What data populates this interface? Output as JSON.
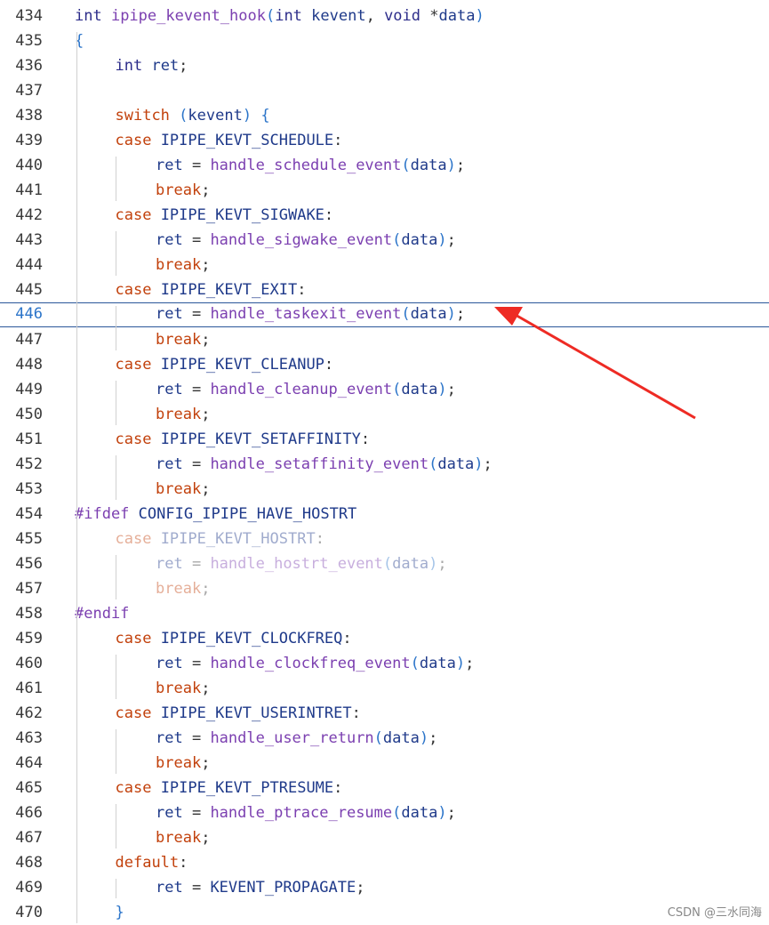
{
  "editor": {
    "current_line": "446",
    "lines": [
      {
        "num": "434",
        "indent": 0,
        "tokens": [
          [
            "ty",
            "int "
          ],
          [
            "fn",
            "ipipe_kevent_hook"
          ],
          [
            "br",
            "("
          ],
          [
            "ty",
            "int "
          ],
          [
            "id",
            "kevent"
          ],
          [
            "pu",
            ", "
          ],
          [
            "ty",
            "void "
          ],
          [
            "pu",
            "*"
          ],
          [
            "id",
            "data"
          ],
          [
            "br",
            ")"
          ]
        ]
      },
      {
        "num": "435",
        "indent": 0,
        "tokens": [
          [
            "br",
            "{"
          ]
        ]
      },
      {
        "num": "436",
        "indent": 1,
        "tokens": [
          [
            "ty",
            "int "
          ],
          [
            "id",
            "ret"
          ],
          [
            "pu",
            ";"
          ]
        ]
      },
      {
        "num": "437",
        "indent": 0,
        "tokens": []
      },
      {
        "num": "438",
        "indent": 1,
        "tokens": [
          [
            "kw",
            "switch "
          ],
          [
            "br",
            "("
          ],
          [
            "id",
            "kevent"
          ],
          [
            "br",
            ")"
          ],
          [
            "pu",
            " "
          ],
          [
            "br",
            "{"
          ]
        ]
      },
      {
        "num": "439",
        "indent": 1,
        "tokens": [
          [
            "kw",
            "case "
          ],
          [
            "id",
            "IPIPE_KEVT_SCHEDULE"
          ],
          [
            "pu",
            ":"
          ]
        ]
      },
      {
        "num": "440",
        "indent": 2,
        "tokens": [
          [
            "id",
            "ret "
          ],
          [
            "pu",
            "= "
          ],
          [
            "fn",
            "handle_schedule_event"
          ],
          [
            "br",
            "("
          ],
          [
            "id",
            "data"
          ],
          [
            "br",
            ")"
          ],
          [
            "pu",
            ";"
          ]
        ]
      },
      {
        "num": "441",
        "indent": 2,
        "tokens": [
          [
            "kw",
            "break"
          ],
          [
            "pu",
            ";"
          ]
        ]
      },
      {
        "num": "442",
        "indent": 1,
        "tokens": [
          [
            "kw",
            "case "
          ],
          [
            "id",
            "IPIPE_KEVT_SIGWAKE"
          ],
          [
            "pu",
            ":"
          ]
        ]
      },
      {
        "num": "443",
        "indent": 2,
        "tokens": [
          [
            "id",
            "ret "
          ],
          [
            "pu",
            "= "
          ],
          [
            "fn",
            "handle_sigwake_event"
          ],
          [
            "br",
            "("
          ],
          [
            "id",
            "data"
          ],
          [
            "br",
            ")"
          ],
          [
            "pu",
            ";"
          ]
        ]
      },
      {
        "num": "444",
        "indent": 2,
        "tokens": [
          [
            "kw",
            "break"
          ],
          [
            "pu",
            ";"
          ]
        ]
      },
      {
        "num": "445",
        "indent": 1,
        "tokens": [
          [
            "kw",
            "case "
          ],
          [
            "id",
            "IPIPE_KEVT_EXIT"
          ],
          [
            "pu",
            ":"
          ]
        ]
      },
      {
        "num": "446",
        "indent": 2,
        "tokens": [
          [
            "id",
            "ret "
          ],
          [
            "pu",
            "= "
          ],
          [
            "fn",
            "handle_taskexit_event"
          ],
          [
            "br",
            "("
          ],
          [
            "id",
            "data"
          ],
          [
            "br",
            ")"
          ],
          [
            "pu",
            ";"
          ]
        ]
      },
      {
        "num": "447",
        "indent": 2,
        "tokens": [
          [
            "kw",
            "break"
          ],
          [
            "pu",
            ";"
          ]
        ]
      },
      {
        "num": "448",
        "indent": 1,
        "tokens": [
          [
            "kw",
            "case "
          ],
          [
            "id",
            "IPIPE_KEVT_CLEANUP"
          ],
          [
            "pu",
            ":"
          ]
        ]
      },
      {
        "num": "449",
        "indent": 2,
        "tokens": [
          [
            "id",
            "ret "
          ],
          [
            "pu",
            "= "
          ],
          [
            "fn",
            "handle_cleanup_event"
          ],
          [
            "br",
            "("
          ],
          [
            "id",
            "data"
          ],
          [
            "br",
            ")"
          ],
          [
            "pu",
            ";"
          ]
        ]
      },
      {
        "num": "450",
        "indent": 2,
        "tokens": [
          [
            "kw",
            "break"
          ],
          [
            "pu",
            ";"
          ]
        ]
      },
      {
        "num": "451",
        "indent": 1,
        "tokens": [
          [
            "kw",
            "case "
          ],
          [
            "id",
            "IPIPE_KEVT_SETAFFINITY"
          ],
          [
            "pu",
            ":"
          ]
        ]
      },
      {
        "num": "452",
        "indent": 2,
        "tokens": [
          [
            "id",
            "ret "
          ],
          [
            "pu",
            "= "
          ],
          [
            "fn",
            "handle_setaffinity_event"
          ],
          [
            "br",
            "("
          ],
          [
            "id",
            "data"
          ],
          [
            "br",
            ")"
          ],
          [
            "pu",
            ";"
          ]
        ]
      },
      {
        "num": "453",
        "indent": 2,
        "tokens": [
          [
            "kw",
            "break"
          ],
          [
            "pu",
            ";"
          ]
        ]
      },
      {
        "num": "454",
        "indent": 0,
        "tokens": [
          [
            "pp",
            "#ifdef "
          ],
          [
            "id",
            "CONFIG_IPIPE_HAVE_HOSTRT"
          ]
        ]
      },
      {
        "num": "455",
        "indent": 1,
        "dim": true,
        "tokens": [
          [
            "kw",
            "case "
          ],
          [
            "id",
            "IPIPE_KEVT_HOSTRT"
          ],
          [
            "pu",
            ":"
          ]
        ]
      },
      {
        "num": "456",
        "indent": 2,
        "dim": true,
        "tokens": [
          [
            "id",
            "ret "
          ],
          [
            "pu",
            "= "
          ],
          [
            "fn",
            "handle_hostrt_event"
          ],
          [
            "br",
            "("
          ],
          [
            "id",
            "data"
          ],
          [
            "br",
            ")"
          ],
          [
            "pu",
            ";"
          ]
        ]
      },
      {
        "num": "457",
        "indent": 2,
        "dim": true,
        "tokens": [
          [
            "kw",
            "break"
          ],
          [
            "pu",
            ";"
          ]
        ]
      },
      {
        "num": "458",
        "indent": 0,
        "tokens": [
          [
            "pp",
            "#endif"
          ]
        ]
      },
      {
        "num": "459",
        "indent": 1,
        "tokens": [
          [
            "kw",
            "case "
          ],
          [
            "id",
            "IPIPE_KEVT_CLOCKFREQ"
          ],
          [
            "pu",
            ":"
          ]
        ]
      },
      {
        "num": "460",
        "indent": 2,
        "tokens": [
          [
            "id",
            "ret "
          ],
          [
            "pu",
            "= "
          ],
          [
            "fn",
            "handle_clockfreq_event"
          ],
          [
            "br",
            "("
          ],
          [
            "id",
            "data"
          ],
          [
            "br",
            ")"
          ],
          [
            "pu",
            ";"
          ]
        ]
      },
      {
        "num": "461",
        "indent": 2,
        "tokens": [
          [
            "kw",
            "break"
          ],
          [
            "pu",
            ";"
          ]
        ]
      },
      {
        "num": "462",
        "indent": 1,
        "tokens": [
          [
            "kw",
            "case "
          ],
          [
            "id",
            "IPIPE_KEVT_USERINTRET"
          ],
          [
            "pu",
            ":"
          ]
        ]
      },
      {
        "num": "463",
        "indent": 2,
        "tokens": [
          [
            "id",
            "ret "
          ],
          [
            "pu",
            "= "
          ],
          [
            "fn",
            "handle_user_return"
          ],
          [
            "br",
            "("
          ],
          [
            "id",
            "data"
          ],
          [
            "br",
            ")"
          ],
          [
            "pu",
            ";"
          ]
        ]
      },
      {
        "num": "464",
        "indent": 2,
        "tokens": [
          [
            "kw",
            "break"
          ],
          [
            "pu",
            ";"
          ]
        ]
      },
      {
        "num": "465",
        "indent": 1,
        "tokens": [
          [
            "kw",
            "case "
          ],
          [
            "id",
            "IPIPE_KEVT_PTRESUME"
          ],
          [
            "pu",
            ":"
          ]
        ]
      },
      {
        "num": "466",
        "indent": 2,
        "tokens": [
          [
            "id",
            "ret "
          ],
          [
            "pu",
            "= "
          ],
          [
            "fn",
            "handle_ptrace_resume"
          ],
          [
            "br",
            "("
          ],
          [
            "id",
            "data"
          ],
          [
            "br",
            ")"
          ],
          [
            "pu",
            ";"
          ]
        ]
      },
      {
        "num": "467",
        "indent": 2,
        "tokens": [
          [
            "kw",
            "break"
          ],
          [
            "pu",
            ";"
          ]
        ]
      },
      {
        "num": "468",
        "indent": 1,
        "tokens": [
          [
            "kw",
            "default"
          ],
          [
            "pu",
            ":"
          ]
        ]
      },
      {
        "num": "469",
        "indent": 2,
        "tokens": [
          [
            "id",
            "ret "
          ],
          [
            "pu",
            "= "
          ],
          [
            "id",
            "KEVENT_PROPAGATE"
          ],
          [
            "pu",
            ";"
          ]
        ]
      },
      {
        "num": "470",
        "indent": 1,
        "tokens": [
          [
            "br",
            "}"
          ]
        ]
      }
    ]
  },
  "annotation": {
    "type": "red-arrow",
    "color": "#ee2b24",
    "points_to_line": "446"
  },
  "watermark": "CSDN @三水同海"
}
